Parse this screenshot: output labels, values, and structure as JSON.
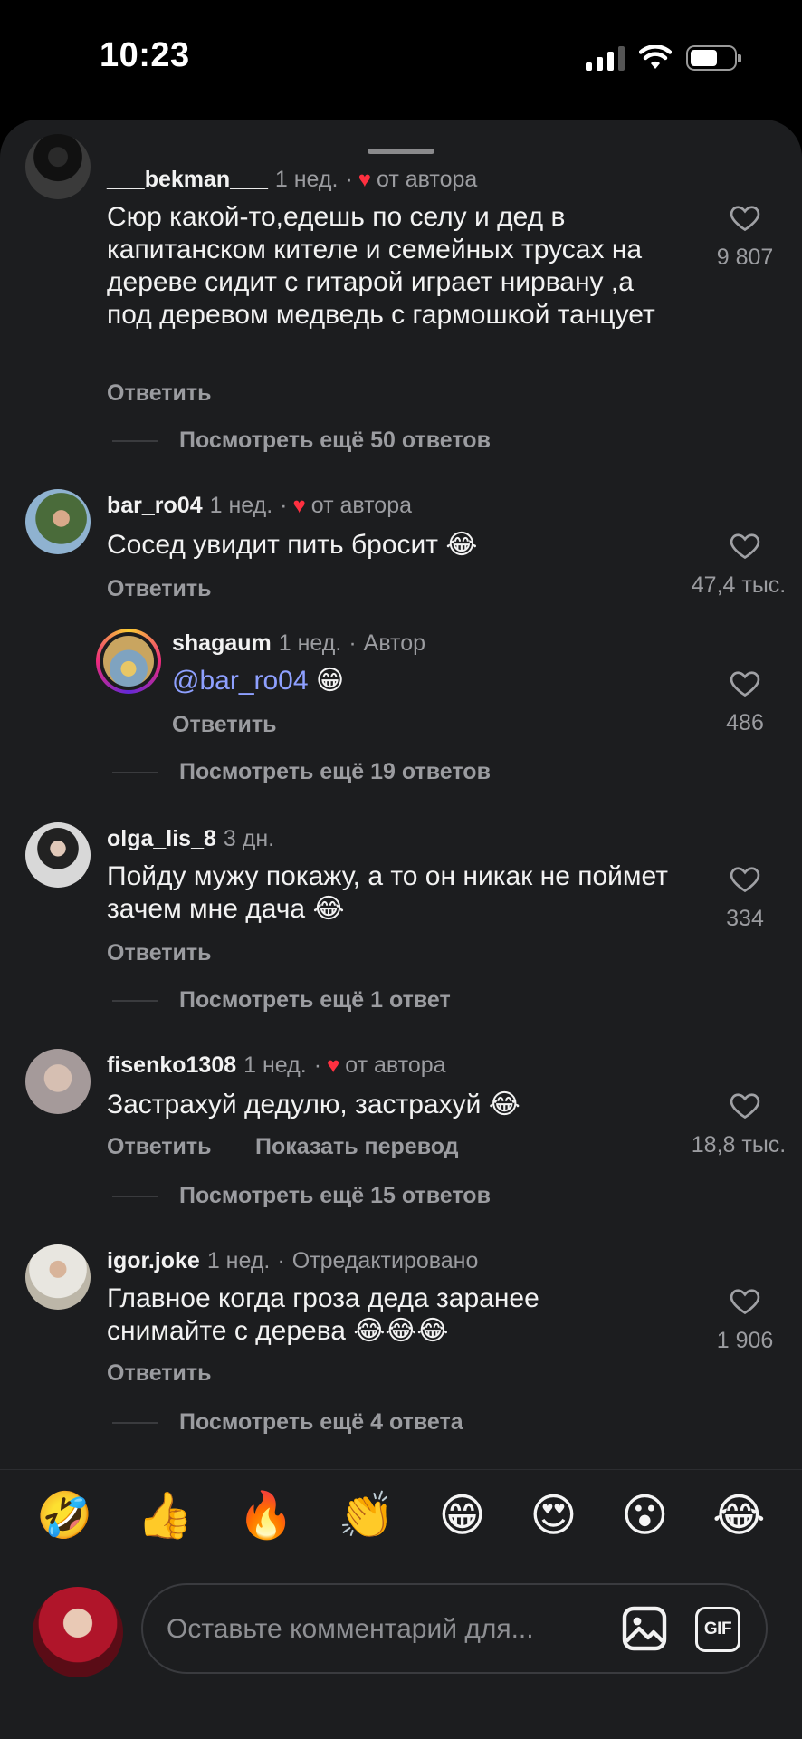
{
  "status_bar": {
    "time": "10:23"
  },
  "comments": [
    {
      "user": "___bekman___",
      "time": "1 нед.",
      "sep": "·",
      "badge": "от автора",
      "text": "Сюр какой-то,едешь по селу и дед в капитанском кителе и семейных трусах на дереве сидит с гитарой играет нирвану ,а под деревом медведь с гармошкой танцует",
      "reply": "Ответить",
      "likes": "9 807",
      "more": "Посмотреть ещё 50 ответов"
    },
    {
      "user": "bar_ro04",
      "time": "1 нед.",
      "sep": "·",
      "badge": "от автора",
      "text": "Сосед увидит пить бросит 😂",
      "reply": "Ответить",
      "likes": "47,4 тыс."
    },
    {
      "user": "shagaum",
      "time": "1 нед.",
      "sep": "·",
      "badge": "Автор",
      "mention": "@bar_ro04",
      "text_after": " 😁",
      "reply": "Ответить",
      "likes": "486",
      "more": "Посмотреть ещё 19 ответов"
    },
    {
      "user": "olga_lis_8",
      "time": "3 дн.",
      "text": "Пойду мужу покажу, а то он никак не поймет зачем мне дача 😂",
      "reply": "Ответить",
      "likes": "334",
      "more": "Посмотреть ещё 1 ответ"
    },
    {
      "user": "fisenko1308",
      "time": "1 нед.",
      "sep": "·",
      "badge": "от автора",
      "text": "Застрахуй дедулю, застрахуй 😂",
      "reply": "Ответить",
      "translate": "Показать перевод",
      "likes": "18,8 тыс.",
      "more": "Посмотреть ещё 15 ответов"
    },
    {
      "user": "igor.joke",
      "time": "1 нед.",
      "sep": "·",
      "badge": "Отредактировано",
      "text": "Главное когда гроза деда заранее снимайте с дерева 😂😂😂",
      "reply": "Ответить",
      "likes": "1 906",
      "more": "Посмотреть ещё 4 ответа"
    }
  ],
  "emoji_bar": [
    "🤣",
    "👍",
    "🔥",
    "👏",
    "😁",
    "😍",
    "😮",
    "😂"
  ],
  "composer": {
    "placeholder": "Оставьте комментарий для...",
    "gif_label": "GIF"
  },
  "colors": {
    "background": "#1c1d1f",
    "accent_heart": "#ff3040",
    "mention": "#8ea0ff"
  }
}
